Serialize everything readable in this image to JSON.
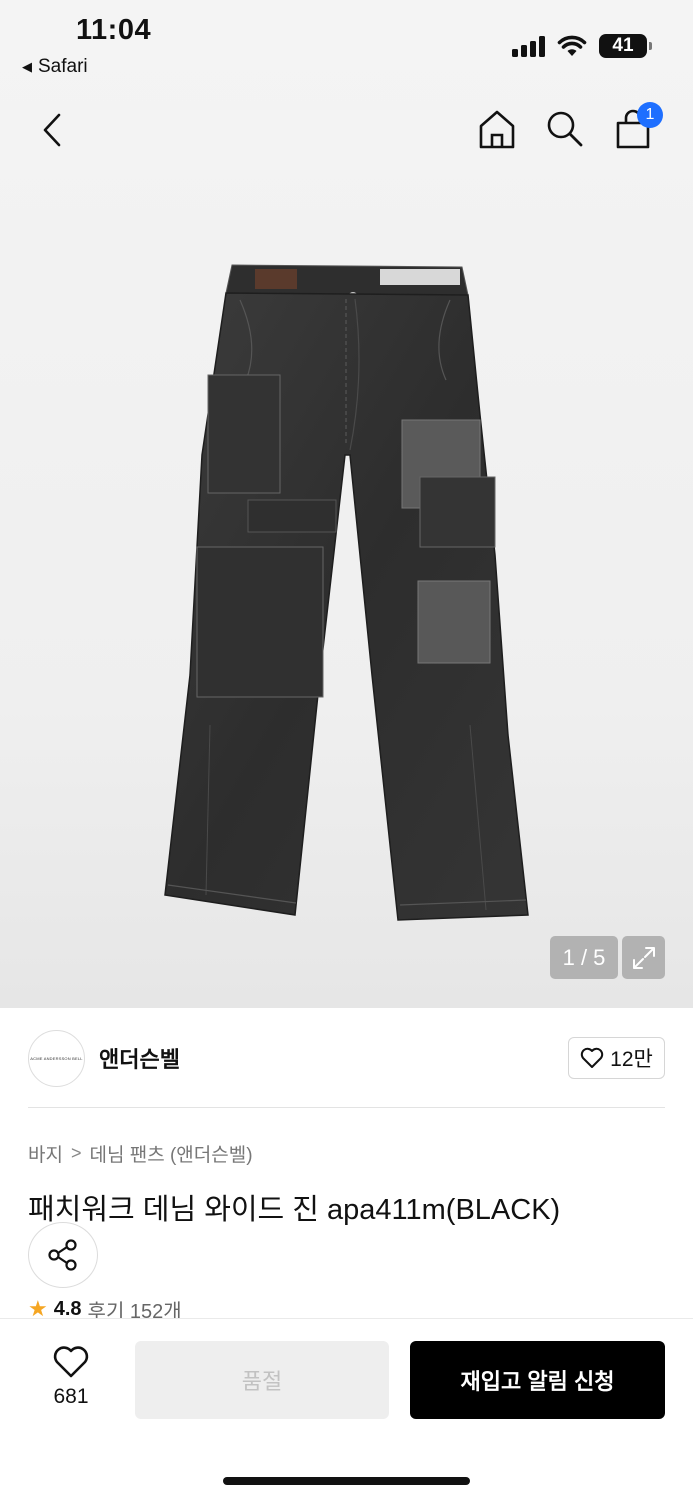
{
  "status_bar": {
    "time": "11:04",
    "back_app": "Safari",
    "battery": "41"
  },
  "nav": {
    "cart_count": "1",
    "icons": [
      "back-icon",
      "home-icon",
      "search-icon",
      "cart-icon"
    ]
  },
  "gallery": {
    "pager": "1 / 5",
    "image_alt": "black patchwork denim wide jeans"
  },
  "brand": {
    "logo_text": "ACME ANDERSSON BELL",
    "name": "앤더슨벨",
    "likes": "12만"
  },
  "breadcrumb": {
    "level1": "바지",
    "separator": ">",
    "level2": "데님 팬츠 (앤더슨벨)"
  },
  "product": {
    "title": "패치워크 데님 와이드 진 apa411m(BLACK)",
    "rating": "4.8",
    "reviews": "후기 152개"
  },
  "bottom_bar": {
    "wish_count": "681",
    "soldout_label": "품절",
    "restock_label": "재입고 알림 신청"
  },
  "colors": {
    "accent_badge": "#1e6fff",
    "star": "#f5a623",
    "primary_button": "#000000",
    "disabled_button": "#eeeeee"
  }
}
